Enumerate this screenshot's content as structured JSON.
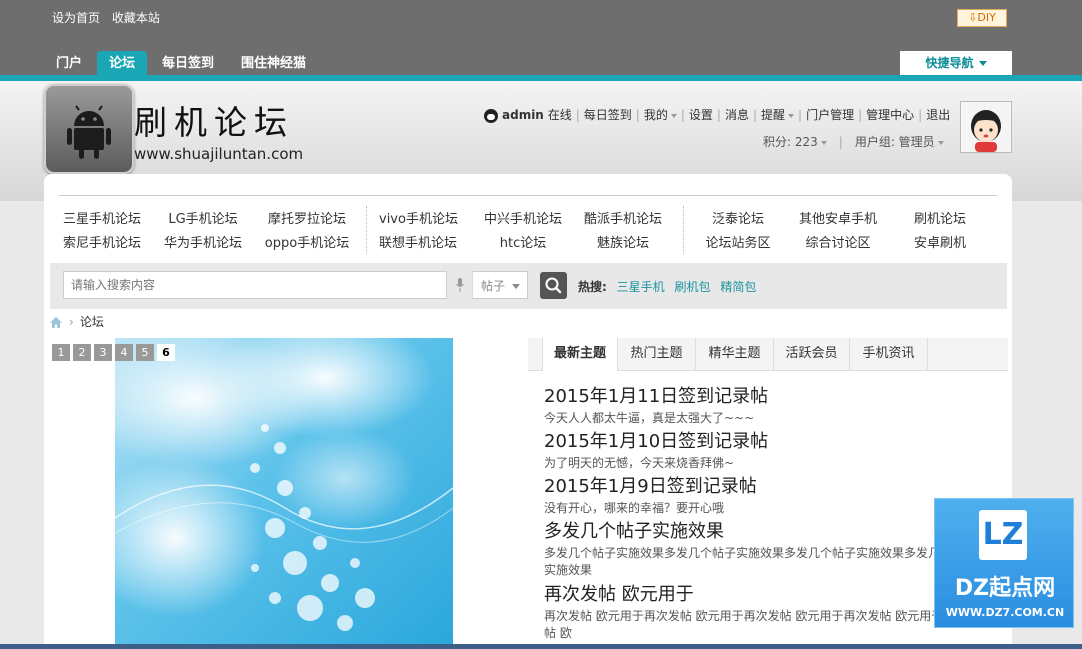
{
  "top": {
    "links": [
      "设为首页",
      "收藏本站"
    ],
    "diy_label": "DIY",
    "diy_icon": "download-arrow-icon"
  },
  "nav": {
    "items": [
      "门户",
      "论坛",
      "每日签到",
      "围住神经猫"
    ],
    "active": "论坛",
    "quicknav_label": "快捷导航"
  },
  "logo": {
    "title": "刷机论坛",
    "url": "www.shuajiluntan.com",
    "icon": "android-icon"
  },
  "user": {
    "name": "admin",
    "status": "在线",
    "links": [
      "每日签到",
      "我的",
      "设置",
      "消息",
      "提醒",
      "门户管理",
      "管理中心",
      "退出"
    ],
    "points_label": "积分: 223",
    "group_label": "用户组: 管理员"
  },
  "forums": {
    "col1": [
      "三星手机论坛",
      "索尼手机论坛"
    ],
    "col2": [
      "LG手机论坛",
      "华为手机论坛"
    ],
    "col3": [
      "摩托罗拉论坛",
      "oppo手机论坛"
    ],
    "col4": [
      "vivo手机论坛",
      "联想手机论坛"
    ],
    "col5": [
      "中兴手机论坛",
      "htc论坛"
    ],
    "col6": [
      "酷派手机论坛",
      "魅族论坛"
    ],
    "col7": [
      "泛泰论坛",
      "论坛站务区"
    ],
    "col8": [
      "其他安卓手机",
      "综合讨论区"
    ],
    "col9": [
      "刷机论坛",
      "安卓刷机"
    ]
  },
  "search": {
    "placeholder": "请输入搜索内容",
    "type": "帖子",
    "hot_label": "热搜:",
    "hot": [
      "三星手机",
      "刷机包",
      "精简包"
    ]
  },
  "breadcrumb": {
    "current": "论坛"
  },
  "slider": {
    "pages": [
      "1",
      "2",
      "3",
      "4",
      "5",
      "6"
    ],
    "current": "6"
  },
  "tabs": [
    "最新主题",
    "热门主题",
    "精华主题",
    "活跃会员",
    "手机资讯"
  ],
  "active_tab": "最新主题",
  "threads": [
    {
      "title": "2015年1月11日签到记录帖",
      "desc": "今天人人都太牛逼，真是太强大了~~~"
    },
    {
      "title": "2015年1月10日签到记录帖",
      "desc": "为了明天的无憾，今天来烧香拜佛~"
    },
    {
      "title": "2015年1月9日签到记录帖",
      "desc": "没有开心，哪来的幸福？要开心哦"
    },
    {
      "title": "多发几个帖子实施效果",
      "desc": "多发几个帖子实施效果多发几个帖子实施效果多发几个帖子实施效果多发几个帖子实施效果"
    },
    {
      "title": "再次发帖 欧元用于",
      "desc": "再次发帖 欧元用于再次发帖 欧元用于再次发帖 欧元用于再次发帖 欧元用于再次发帖 欧"
    }
  ],
  "watermark": {
    "logo": "LZ",
    "name": "DZ起点网",
    "url": "WWW.DZ7.COM.CN"
  }
}
